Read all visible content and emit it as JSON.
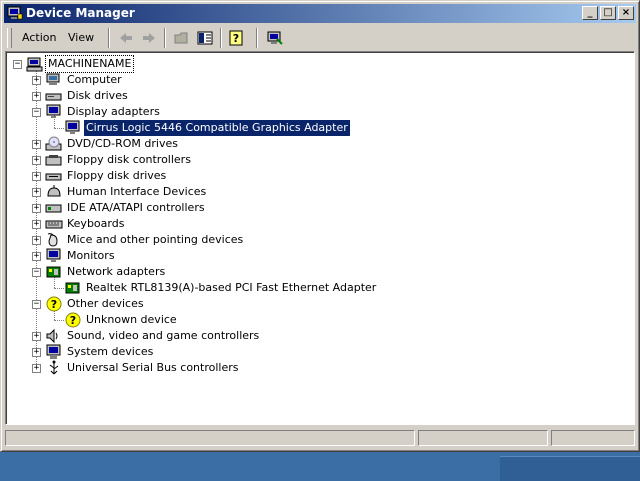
{
  "window": {
    "title": "Device Manager",
    "controls": {
      "minimize": "_",
      "maximize": "□",
      "close": "×"
    }
  },
  "menu": {
    "items": [
      {
        "label": "Action"
      },
      {
        "label": "View"
      }
    ]
  },
  "toolbar": {
    "icons": [
      "back-icon",
      "forward-icon",
      "folder-icon",
      "show-hide-tree-icon",
      "help-icon",
      "properties-icon"
    ]
  },
  "tree": {
    "root": "MACHINENAME",
    "items": [
      {
        "label": "Computer",
        "icon": "computer-icon"
      },
      {
        "label": "Disk drives",
        "icon": "disk-drive-icon"
      },
      {
        "label": "Display adapters",
        "icon": "monitor-icon",
        "expanded": true,
        "children": [
          {
            "label": "Cirrus Logic 5446 Compatible Graphics Adapter",
            "selected": true
          }
        ]
      },
      {
        "label": "DVD/CD-ROM drives",
        "icon": "cdrom-icon"
      },
      {
        "label": "Floppy disk controllers",
        "icon": "floppy-controller-icon"
      },
      {
        "label": "Floppy disk drives",
        "icon": "floppy-drive-icon"
      },
      {
        "label": "Human Interface Devices",
        "icon": "hid-icon"
      },
      {
        "label": "IDE ATA/ATAPI controllers",
        "icon": "ide-icon"
      },
      {
        "label": "Keyboards",
        "icon": "keyboard-icon"
      },
      {
        "label": "Mice and other pointing devices",
        "icon": "mouse-icon"
      },
      {
        "label": "Monitors",
        "icon": "monitor-icon"
      },
      {
        "label": "Network adapters",
        "icon": "network-icon",
        "expanded": true,
        "children": [
          {
            "label": "Realtek RTL8139(A)-based PCI Fast Ethernet Adapter"
          }
        ]
      },
      {
        "label": "Other devices",
        "icon": "question-icon",
        "expanded": true,
        "children": [
          {
            "label": "Unknown device"
          }
        ]
      },
      {
        "label": "Sound, video and game controllers",
        "icon": "sound-icon"
      },
      {
        "label": "System devices",
        "icon": "system-icon"
      },
      {
        "label": "Universal Serial Bus controllers",
        "icon": "usb-icon"
      }
    ]
  },
  "status": {
    "panels": [
      "",
      "",
      ""
    ]
  }
}
